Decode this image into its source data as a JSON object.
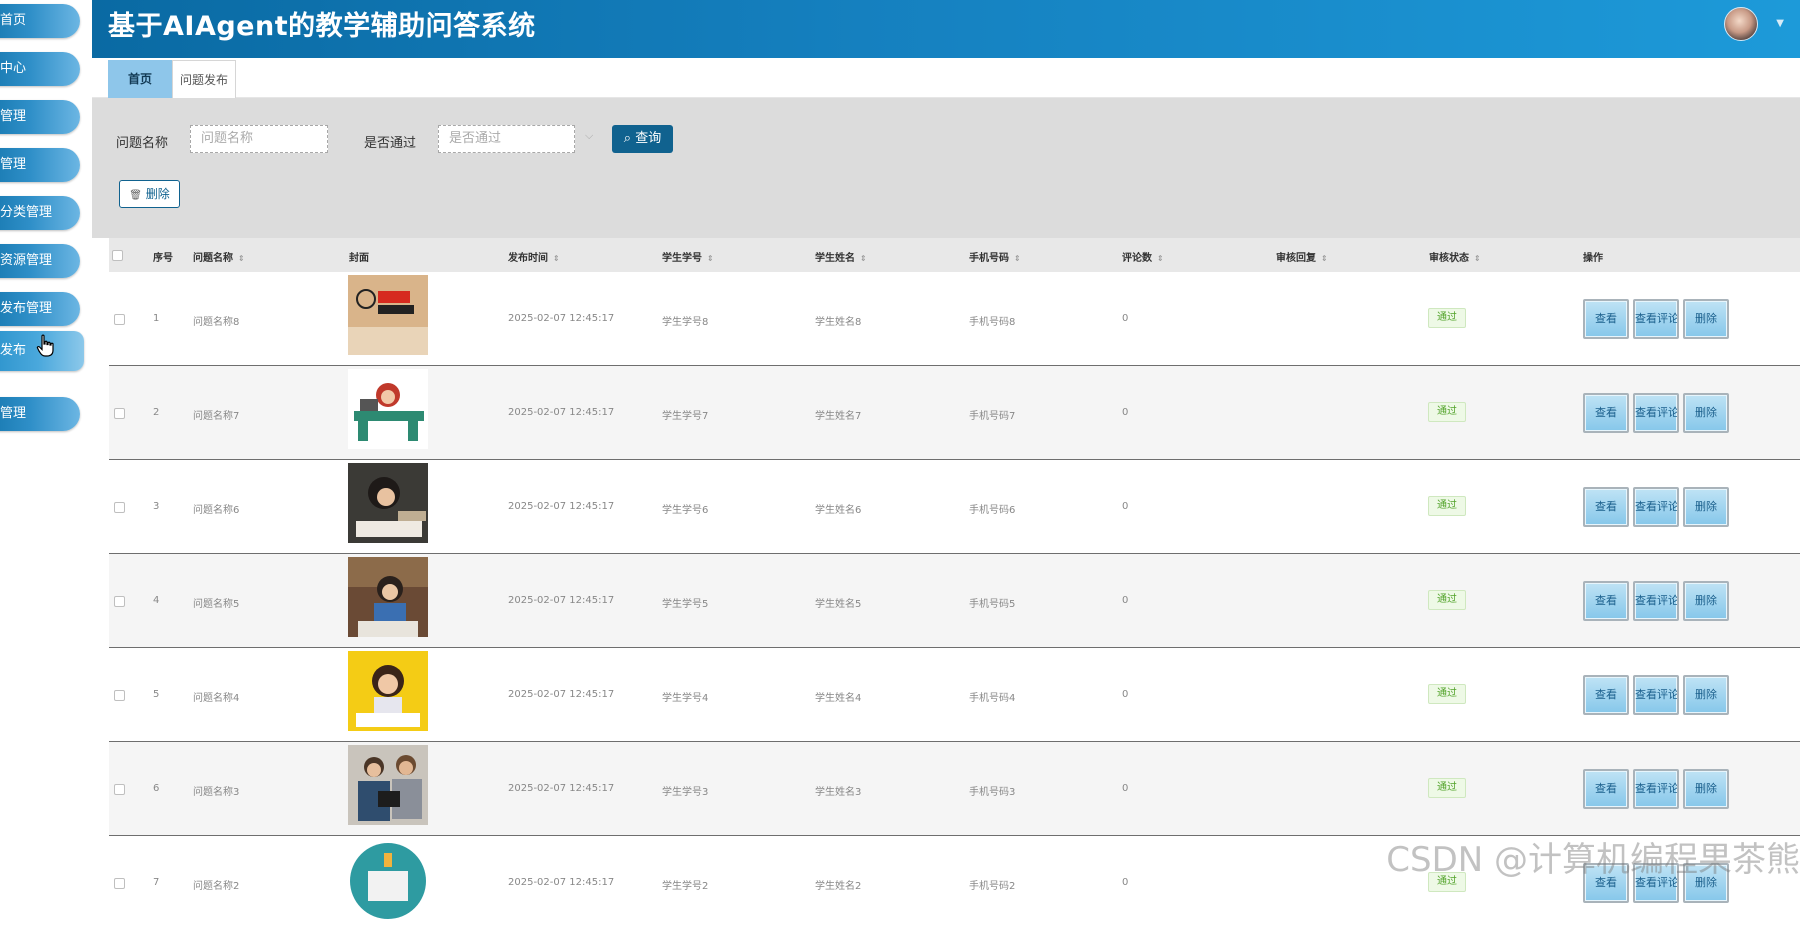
{
  "header": {
    "title": "基于AIAgent的教学辅助问答系统"
  },
  "sidebar": {
    "items": [
      {
        "label": "首页"
      },
      {
        "label": "中心"
      },
      {
        "label": "管理"
      },
      {
        "label": "管理"
      },
      {
        "label": "分类管理"
      },
      {
        "label": "资源管理"
      },
      {
        "label": "发布管理"
      },
      {
        "label": "发布"
      },
      {
        "label": "管理"
      }
    ]
  },
  "tabs": [
    {
      "label": "首页"
    },
    {
      "label": "问题发布"
    }
  ],
  "search": {
    "name_label": "问题名称",
    "name_placeholder": "问题名称",
    "pass_label": "是否通过",
    "pass_placeholder": "是否通过",
    "query_label": "查询",
    "delete_label": "删除"
  },
  "table": {
    "headers": [
      "序号",
      "问题名称",
      "封面",
      "发布时间",
      "学生学号",
      "学生姓名",
      "手机号码",
      "评论数",
      "审核回复",
      "审核状态",
      "操作"
    ],
    "rows": [
      {
        "index": "1",
        "name": "问题名称8",
        "time": "2025-02-07 12:45:17",
        "student_id": "学生学号8",
        "student_name": "学生姓名8",
        "phone": "手机号码8",
        "comments": "0",
        "status": "通过"
      },
      {
        "index": "2",
        "name": "问题名称7",
        "time": "2025-02-07 12:45:17",
        "student_id": "学生学号7",
        "student_name": "学生姓名7",
        "phone": "手机号码7",
        "comments": "0",
        "status": "通过"
      },
      {
        "index": "3",
        "name": "问题名称6",
        "time": "2025-02-07 12:45:17",
        "student_id": "学生学号6",
        "student_name": "学生姓名6",
        "phone": "手机号码6",
        "comments": "0",
        "status": "通过"
      },
      {
        "index": "4",
        "name": "问题名称5",
        "time": "2025-02-07 12:45:17",
        "student_id": "学生学号5",
        "student_name": "学生姓名5",
        "phone": "手机号码5",
        "comments": "0",
        "status": "通过"
      },
      {
        "index": "5",
        "name": "问题名称4",
        "time": "2025-02-07 12:45:17",
        "student_id": "学生学号4",
        "student_name": "学生姓名4",
        "phone": "手机号码4",
        "comments": "0",
        "status": "通过"
      },
      {
        "index": "6",
        "name": "问题名称3",
        "time": "2025-02-07 12:45:17",
        "student_id": "学生学号3",
        "student_name": "学生姓名3",
        "phone": "手机号码3",
        "comments": "0",
        "status": "通过"
      },
      {
        "index": "7",
        "name": "问题名称2",
        "time": "2025-02-07 12:45:17",
        "student_id": "学生学号2",
        "student_name": "学生姓名2",
        "phone": "手机号码2",
        "comments": "0",
        "status": "通过"
      }
    ],
    "actions": {
      "view": "查看",
      "view_comments": "查看评论",
      "delete": "删除"
    }
  },
  "watermark": "CSDN @计算机编程果茶熊",
  "colors": {
    "header_start": "#0a6aa3",
    "header_end": "#1d9ad9",
    "sidebar_button": "#2f8fc8",
    "query_button": "#10628f",
    "status_pass": "#52a32a"
  }
}
